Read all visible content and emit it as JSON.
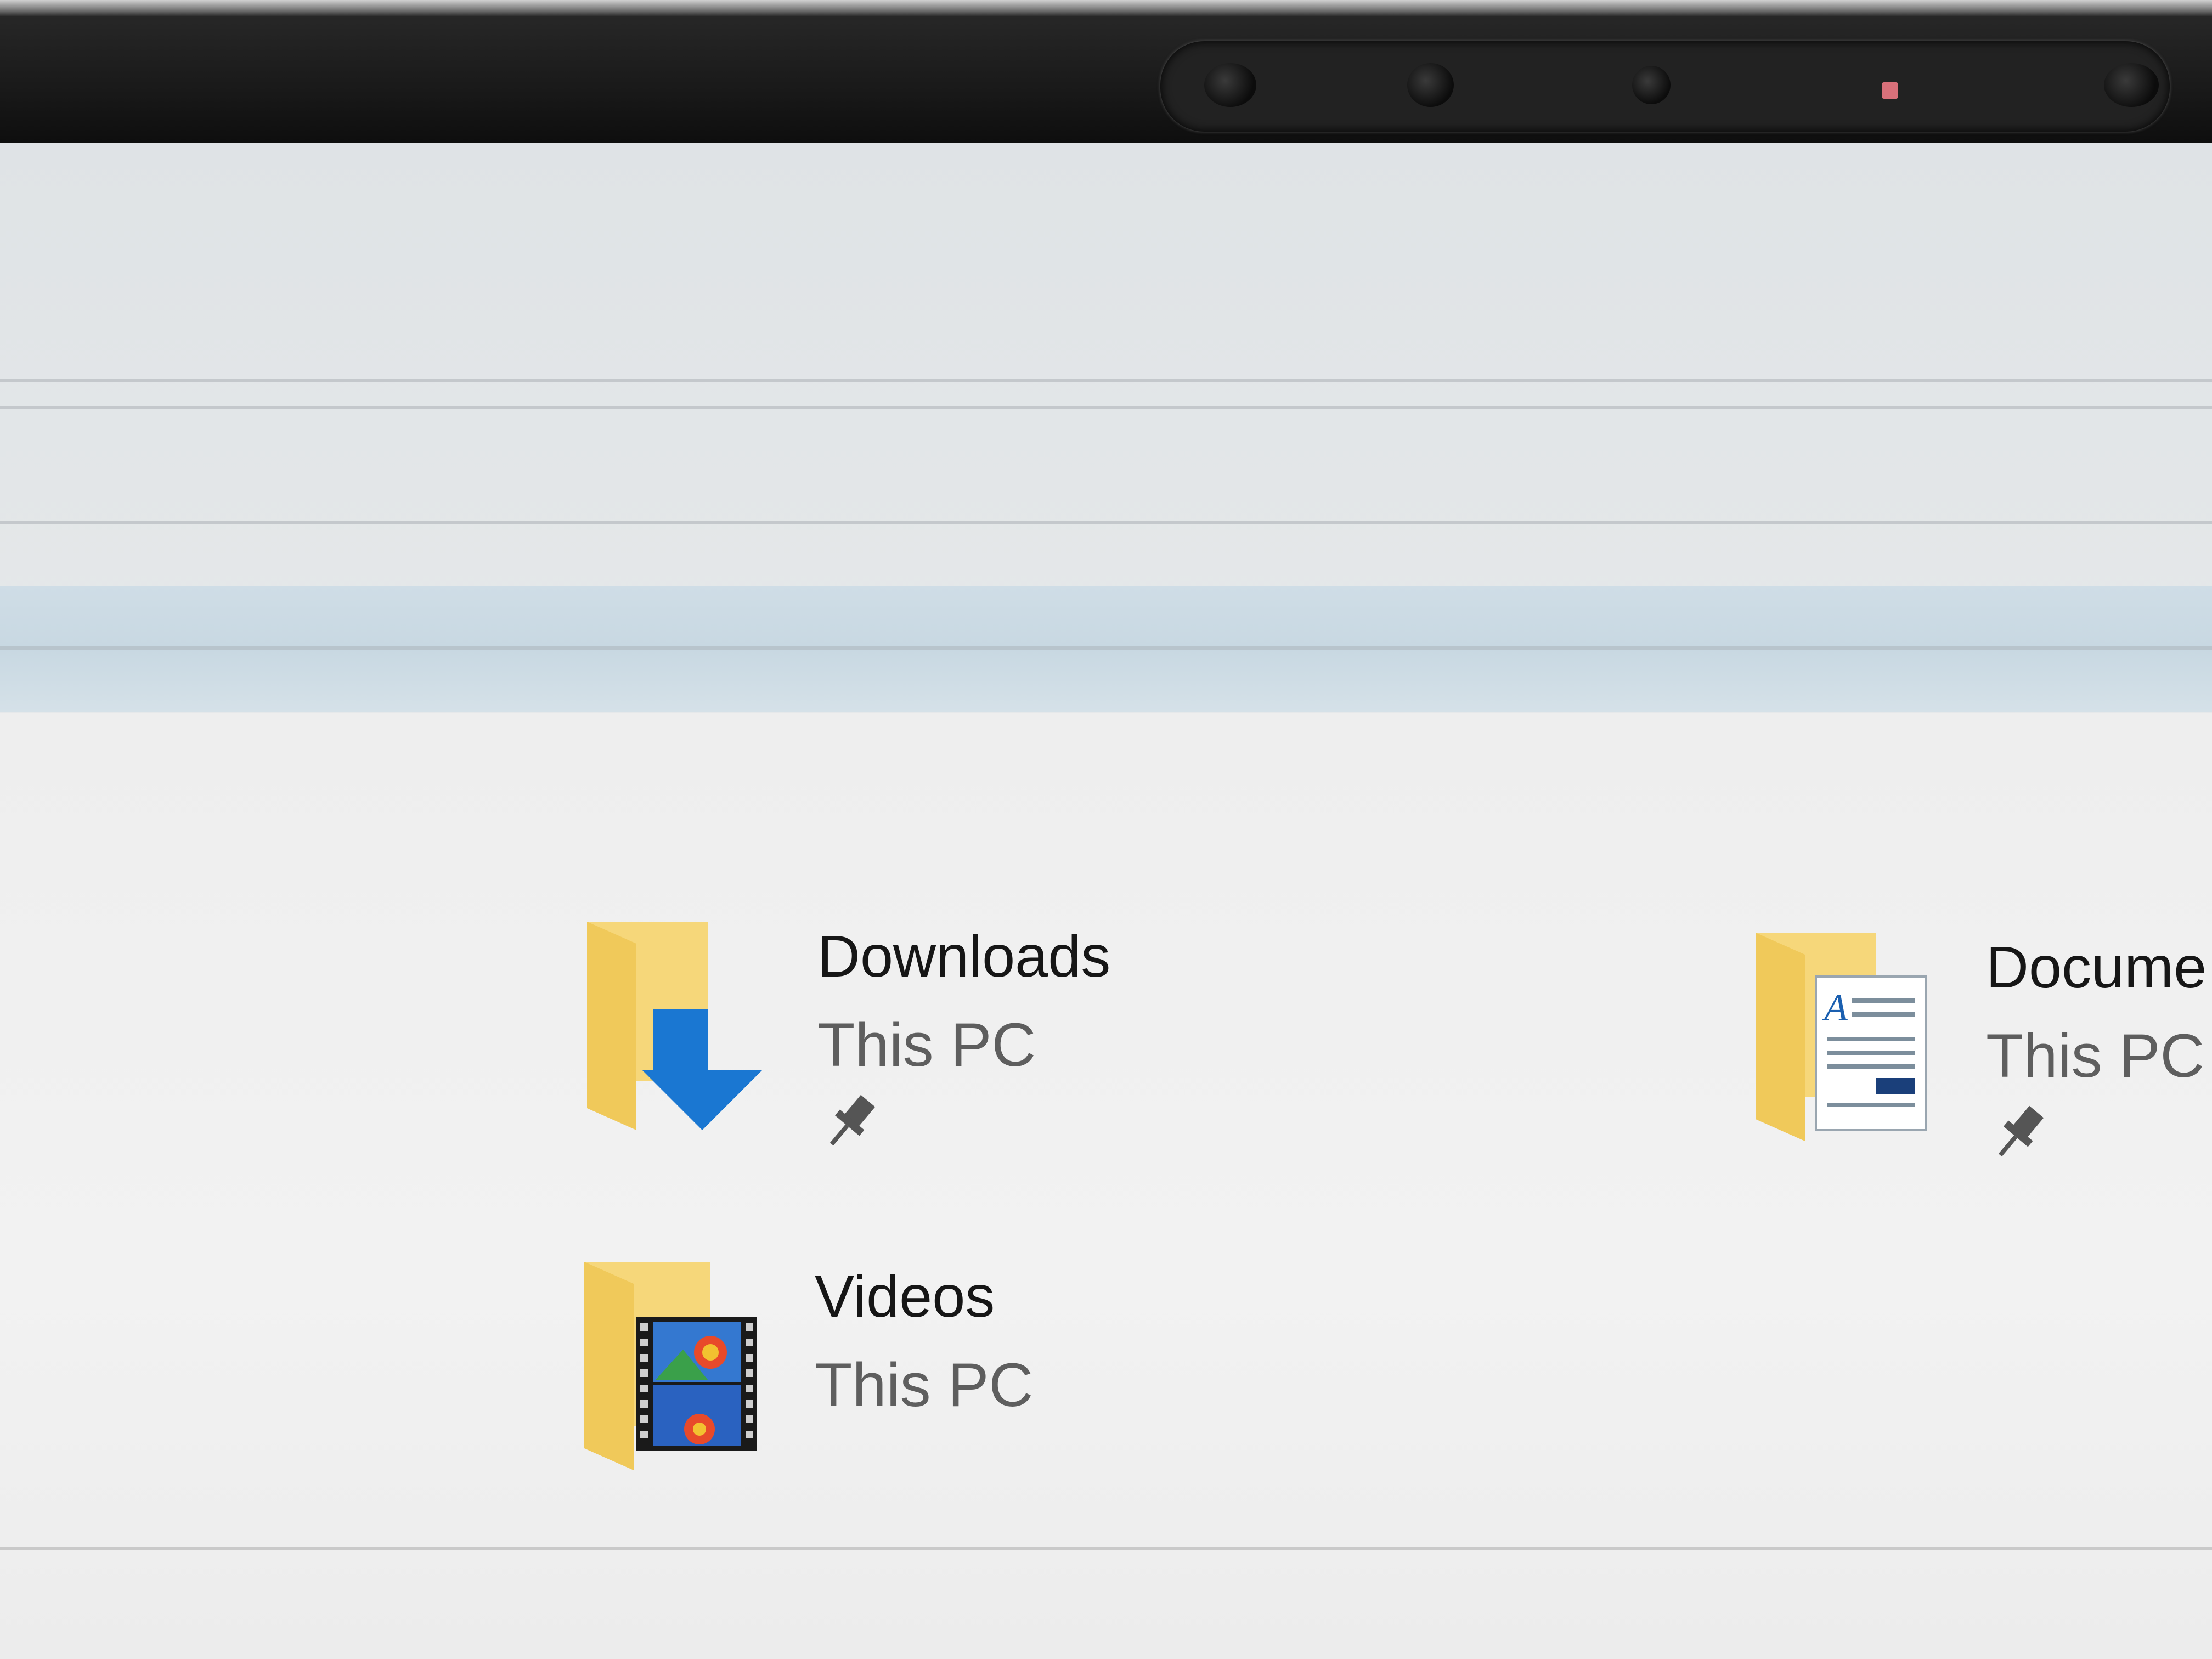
{
  "quick_access": {
    "items": [
      {
        "name": "Downloads",
        "location": "This PC",
        "pinned": true,
        "icon": "downloads-folder-icon"
      },
      {
        "name": "Docume",
        "location": "This PC",
        "pinned": true,
        "icon": "documents-folder-icon"
      },
      {
        "name": "Videos",
        "location": "This PC",
        "pinned": false,
        "icon": "videos-folder-icon"
      }
    ]
  },
  "colors": {
    "folder_yellow": "#f4cf66",
    "download_arrow_blue": "#1a77d2",
    "pane_background": "#eeeeee",
    "selection_band": "#c8d8e2"
  }
}
